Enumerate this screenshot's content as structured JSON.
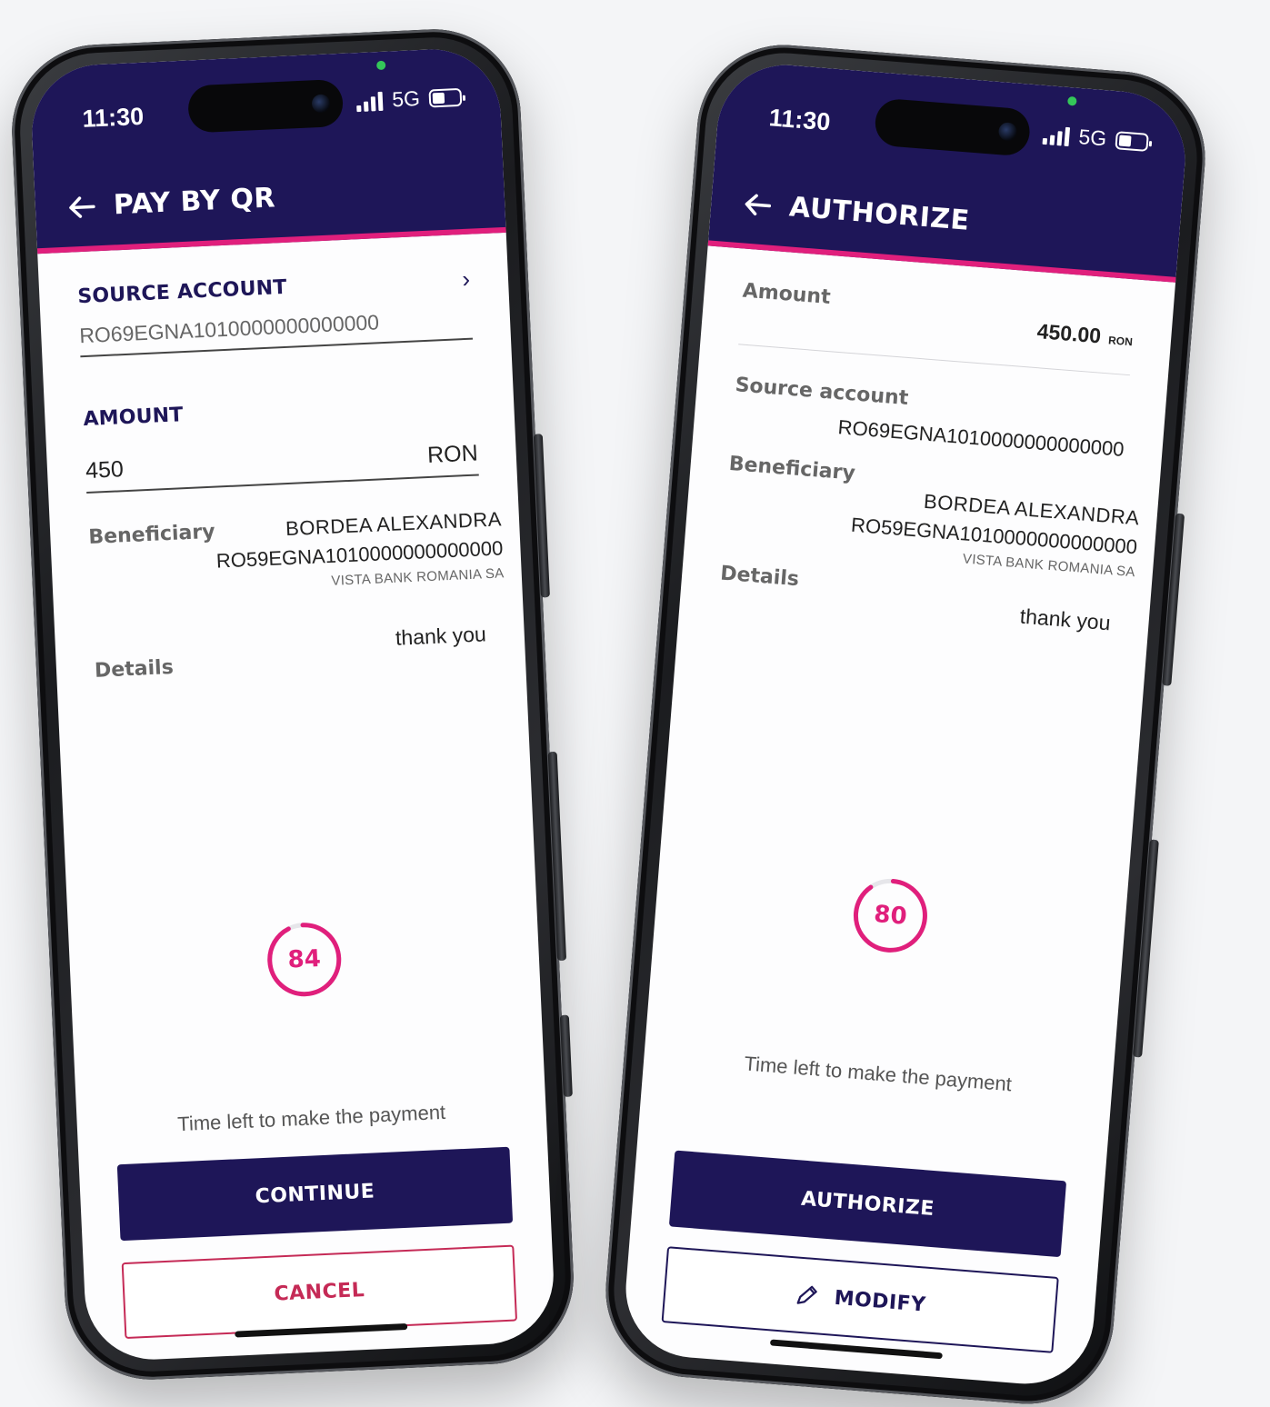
{
  "colors": {
    "header_bg": "#1e1658",
    "accent": "#e01f7c",
    "cancel": "#c52a56",
    "background": "#f4f5f7"
  },
  "status_bar": {
    "time": "11:30",
    "network": "5G"
  },
  "phone_left": {
    "screen_title": "PAY BY QR",
    "source_account": {
      "label": "SOURCE ACCOUNT",
      "value": "RO69EGNA1010000000000000"
    },
    "amount": {
      "label": "AMOUNT",
      "value": "450",
      "currency": "RON"
    },
    "beneficiary": {
      "label": "Beneficiary",
      "name": "BORDEA ALEXANDRA",
      "iban": "RO59EGNA1010000000000000",
      "bank": "VISTA BANK ROMANIA SA"
    },
    "details": {
      "label": "Details",
      "value": "thank you"
    },
    "timer": {
      "seconds": "84",
      "caption": "Time left to make the payment",
      "progress": 0.93
    },
    "continue_label": "CONTINUE",
    "cancel_label": "CANCEL"
  },
  "phone_right": {
    "screen_title": "AUTHORIZE",
    "amount": {
      "label": "Amount",
      "value": "450.00",
      "currency": "RON"
    },
    "source_account": {
      "label": "Source account",
      "value": "RO69EGNA1010000000000000"
    },
    "beneficiary": {
      "label": "Beneficiary",
      "name": "BORDEA ALEXANDRA",
      "iban": "RO59EGNA1010000000000000",
      "bank": "VISTA BANK ROMANIA SA"
    },
    "details": {
      "label": "Details",
      "value": "thank you"
    },
    "timer": {
      "seconds": "80",
      "caption": "Time left to make the payment",
      "progress": 0.89
    },
    "authorize_label": "AUTHORIZE",
    "modify_label": "MODIFY"
  }
}
